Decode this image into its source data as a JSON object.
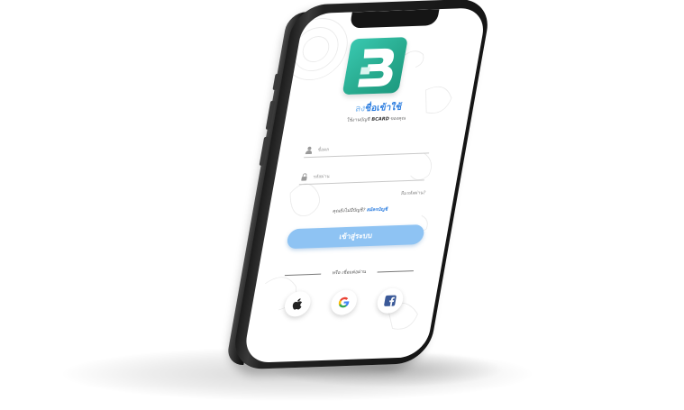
{
  "screen": {
    "title_prefix": "ลง",
    "title_main": "ชื่อเข้าใช้",
    "subtitle_prefix": "ใช้งานบัญชี ",
    "subtitle_brand": "BCARD",
    "subtitle_suffix": " ของคุณ",
    "username_placeholder": "ชื่อผล",
    "password_placeholder": "รหัสผ่าน",
    "forgot_password": "ลืมรหัสผ่าน?",
    "no_account_text": "คุณยังไม่มีบัญชี? ",
    "register_link": "สมัครบัญชี",
    "login_button": "เข้าสู่ระบบ",
    "divider_text": "หรือ เชื่อมต่อผ่าน"
  },
  "logo": {
    "letter": "B",
    "color": "#2bb597"
  },
  "social": [
    {
      "icon": "apple-icon"
    },
    {
      "icon": "google-icon"
    },
    {
      "icon": "facebook-icon"
    }
  ],
  "colors": {
    "accent": "#2f7fe0",
    "button": "#8ec3f3",
    "brand_teal": "#2bb597"
  }
}
